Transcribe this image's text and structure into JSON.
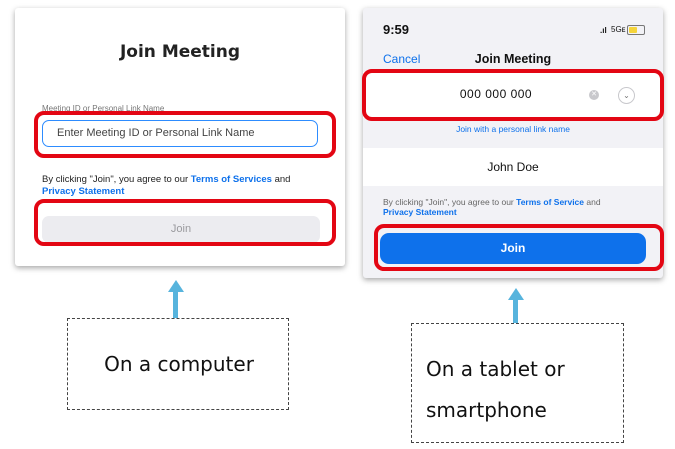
{
  "desktop": {
    "title": "Join Meeting",
    "field_label": "Meeting ID or Personal Link Name",
    "input_placeholder": "Enter Meeting ID or Personal Link Name",
    "terms_prefix": "By clicking \"Join\", you agree to our ",
    "terms_link": "Terms of Services",
    "terms_and": " and",
    "privacy_link": "Privacy Statement",
    "join_label": "Join"
  },
  "phone": {
    "time": "9:59",
    "signal": ".ıl",
    "network": "5Gᴇ",
    "battery_level_percent": 55,
    "cancel_label": "Cancel",
    "title": "Join Meeting",
    "meeting_id_value": "000 000 000",
    "clear_glyph": "✕",
    "dropdown_glyph": "⌄",
    "personal_link_label": "Join with a personal link name",
    "name_value": "John Doe",
    "terms_prefix": "By clicking \"Join\", you agree to our ",
    "terms_link": "Terms of Service",
    "terms_and": " and",
    "privacy_link": "Privacy Statement",
    "join_label": "Join"
  },
  "captions": {
    "computer": "On a computer",
    "mobile_line1": "On a tablet or",
    "mobile_line2": "smartphone"
  },
  "colors": {
    "accent": "#0e71eb",
    "highlight": "#e30613",
    "arrow": "#57b4dd"
  },
  "icons": {
    "clear": "clear-icon",
    "dropdown": "chevron-down-icon",
    "battery": "battery-icon",
    "signal": "signal-icon"
  }
}
